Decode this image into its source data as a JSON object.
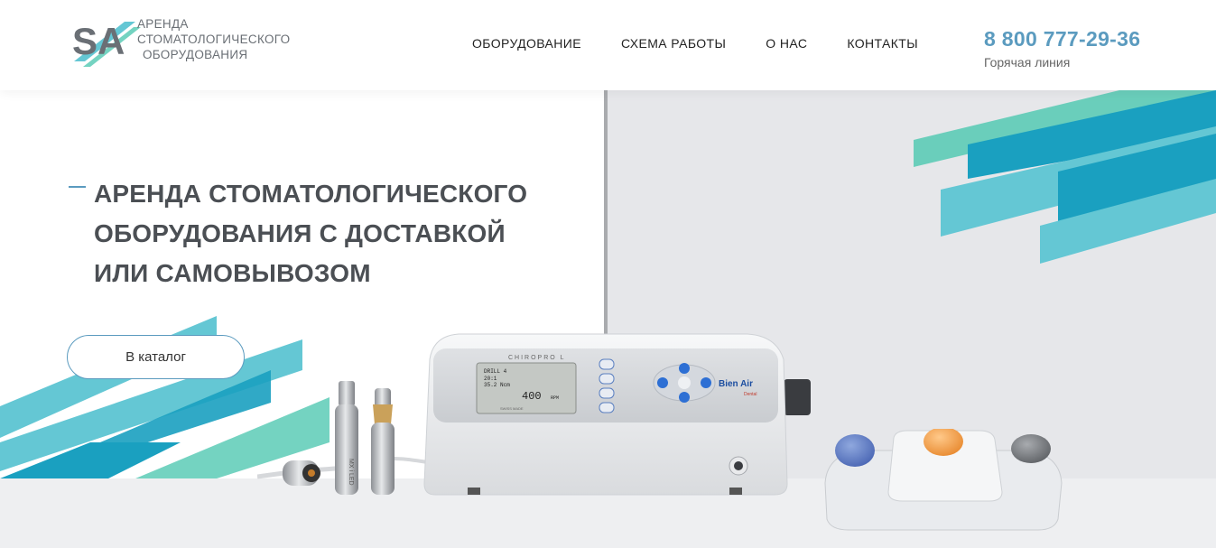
{
  "header": {
    "logo": {
      "mark_letters": "SA",
      "lines": [
        "АРЕНДА",
        "СТОМАТОЛОГИЧЕСКОГО",
        "ОБОРУДОВАНИЯ"
      ]
    },
    "nav": [
      {
        "label": "ОБОРУДОВАНИЕ"
      },
      {
        "label": "СХЕМА РАБОТЫ"
      },
      {
        "label": "О НАС"
      },
      {
        "label": "КОНТАКТЫ"
      }
    ],
    "phone": {
      "number": "8 800 777-29-36",
      "caption": "Горячая линия"
    }
  },
  "hero": {
    "headline_lines": [
      "АРЕНДА СТОМАТОЛОГИЧЕСКОГО",
      "ОБОРУДОВАНИЯ С ДОСТАВКОЙ",
      "ИЛИ САМОВЫВОЗОМ"
    ],
    "cta_label": "В каталог",
    "device": {
      "model_label": "CHIROPRO L",
      "screen_line1": "DRILL 4",
      "screen_line2": "20:1",
      "screen_line3": "35.2 Ncm",
      "screen_rpm": "400",
      "screen_unit": "RPM",
      "screen_sub": "SWISS MADE",
      "brand": "Bien Air",
      "brand_sub": "Dental",
      "handpiece_label": "MX i LED"
    }
  },
  "colors": {
    "accent": "#5b9bbf",
    "teal_light": "#64c7d4",
    "teal_dark": "#1aa0c0",
    "mint": "#5ccbb6",
    "background_gray": "#e6e7ea"
  }
}
